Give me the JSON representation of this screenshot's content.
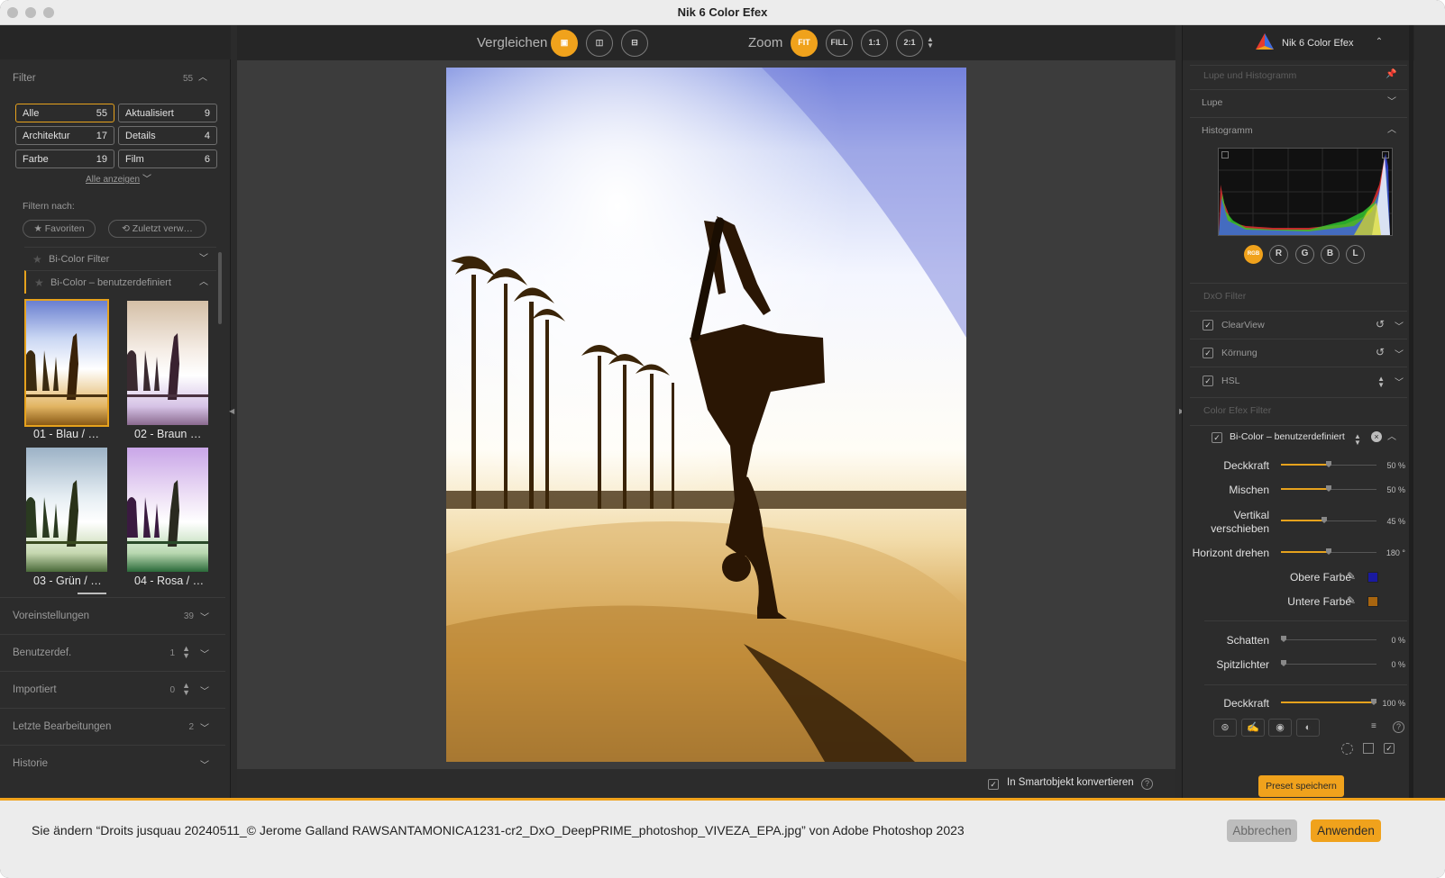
{
  "window": {
    "title": "Nik 6 Color Efex"
  },
  "left_panel": {
    "filter_title": "Filter",
    "filter_count": "55",
    "chips": [
      {
        "label": "Alle",
        "count": "55"
      },
      {
        "label": "Aktualisiert",
        "count": "9"
      },
      {
        "label": "Architektur",
        "count": "17"
      },
      {
        "label": "Details",
        "count": "4"
      },
      {
        "label": "Farbe",
        "count": "19"
      },
      {
        "label": "Film",
        "count": "6"
      }
    ],
    "show_all": "Alle anzeigen",
    "filter_by": "Filtern nach:",
    "favorites": "★ Favoriten",
    "recent": "⟲ Zuletzt verw…",
    "groups": [
      {
        "label": "Bi-Color Filter"
      },
      {
        "label": "Bi-Color – benutzerdefiniert"
      }
    ],
    "thumbnails": [
      {
        "label": "01 - Blau / …"
      },
      {
        "label": "02 - Braun …"
      },
      {
        "label": "03 - Grün / …"
      },
      {
        "label": "04 - Rosa / …"
      }
    ],
    "sections": [
      {
        "title": "Voreinstellungen",
        "count": "39"
      },
      {
        "title": "Benutzerdef.",
        "count": "1"
      },
      {
        "title": "Importiert",
        "count": "0"
      },
      {
        "title": "Letzte Bearbeitungen",
        "count": "2"
      },
      {
        "title": "Historie",
        "count": ""
      }
    ]
  },
  "toolbar": {
    "compare_label": "Vergleichen",
    "zoom_label": "Zoom",
    "zoom_buttons": [
      "FIT",
      "FILL",
      "1:1",
      "2:1"
    ]
  },
  "bottom_bar": {
    "smart_object": "In Smartobjekt konvertieren"
  },
  "right_panel": {
    "app_name": "Nik 6 Color Efex",
    "loupe_histogram": "Lupe und Histogramm",
    "loupe": "Lupe",
    "histogram": "Histogramm",
    "channels": [
      "RGB",
      "R",
      "G",
      "B",
      "L"
    ],
    "dxo_filter": "DxO Filter",
    "dxo_filters": [
      {
        "name": "ClearView"
      },
      {
        "name": "Körnung"
      },
      {
        "name": "HSL"
      }
    ],
    "color_efex_filter": "Color Efex Filter",
    "active_filter": "Bi-Color – benutzerdefiniert",
    "sliders": [
      {
        "label": "Deckkraft",
        "value": "50 %",
        "level": 0.5
      },
      {
        "label": "Mischen",
        "value": "50 %",
        "level": 0.5
      },
      {
        "label": "Vertikal verschieben",
        "value": "45 %",
        "level": 0.45
      },
      {
        "label": "Horizont drehen",
        "value": "180 °",
        "level": 0.5
      }
    ],
    "upper_color": {
      "label": "Obere Farbe",
      "color": "#1a1aa0"
    },
    "lower_color": {
      "label": "Untere Farbe",
      "color": "#a8650f"
    },
    "sliders2": [
      {
        "label": "Schatten",
        "value": "0 %",
        "level": 0
      },
      {
        "label": "Spitzlichter",
        "value": "0 %",
        "level": 0
      }
    ],
    "opacity": {
      "label": "Deckkraft",
      "value": "100 %",
      "level": 1
    },
    "preset_button": "Preset speichern"
  },
  "footer": {
    "message": "Sie ändern “Droits jusquau 20240511_© Jerome Galland RAWSANTAMONICA1231-cr2_DxO_DeepPRIME_photoshop_VIVEZA_EPA.jpg” von Adobe Photoshop 2023",
    "cancel": "Abbrechen",
    "apply": "Anwenden"
  },
  "colors": {
    "accent": "#f0a21c"
  }
}
